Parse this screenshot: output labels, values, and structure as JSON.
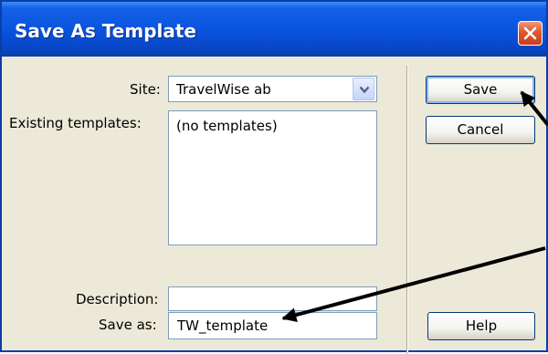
{
  "dialog": {
    "title": "Save As Template"
  },
  "form": {
    "site_label": "Site:",
    "site_value": "TravelWise ab",
    "existing_label": "Existing templates:",
    "existing_items": [
      "(no templates)"
    ],
    "description_label": "Description:",
    "description_value": "",
    "save_as_label": "Save as:",
    "save_as_value": "TW_template"
  },
  "buttons": {
    "save": "Save",
    "cancel": "Cancel",
    "help": "Help"
  },
  "icons": {
    "close": "close-icon",
    "dropdown": "chevron-down-icon",
    "annotation": "arrow-annotation"
  },
  "colors": {
    "titlebar": "#0a54e0",
    "close_button": "#e0552c",
    "dialog_face": "#ece9d8",
    "field_border": "#7f9db9"
  }
}
